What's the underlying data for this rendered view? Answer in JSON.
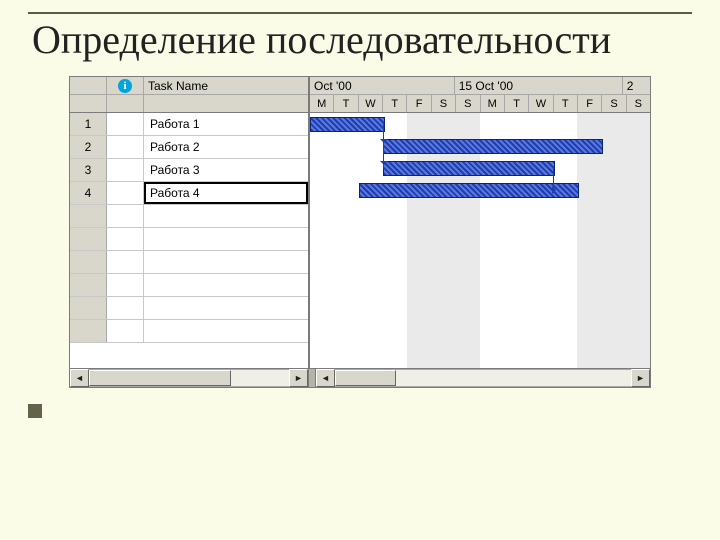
{
  "slide": {
    "title": "Определение последовательности"
  },
  "table": {
    "cols": {
      "id": "",
      "info": "",
      "name": "Task Name"
    },
    "rows": [
      {
        "id": "1",
        "name": "Работа 1"
      },
      {
        "id": "2",
        "name": "Работа 2"
      },
      {
        "id": "3",
        "name": "Работа 3"
      },
      {
        "id": "4",
        "name": "Работа 4",
        "selected": true
      }
    ]
  },
  "timeline": {
    "weeks": [
      "Oct '00",
      "15 Oct '00",
      "2"
    ],
    "days": [
      "M",
      "T",
      "W",
      "T",
      "F",
      "S",
      "S",
      "M",
      "T",
      "W",
      "T",
      "F",
      "S",
      "S"
    ],
    "weekend_idx": [
      4,
      5,
      6,
      11,
      12,
      13
    ]
  },
  "chart_data": {
    "type": "gantt",
    "unit": "day-index (0 = first M column)",
    "tasks": [
      {
        "id": 1,
        "name": "Работа 1",
        "start": 0,
        "end": 3
      },
      {
        "id": 2,
        "name": "Работа 2",
        "start": 3,
        "end": 12
      },
      {
        "id": 3,
        "name": "Работа 3",
        "start": 3,
        "end": 10
      },
      {
        "id": 4,
        "name": "Работа 4",
        "start": 2,
        "end": 11
      }
    ],
    "links": [
      {
        "from": 1,
        "to": 2,
        "type": "FS"
      },
      {
        "from": 1,
        "to": 3,
        "type": "FS"
      },
      {
        "from": 3,
        "to": 4,
        "type": "FS-end"
      }
    ]
  }
}
